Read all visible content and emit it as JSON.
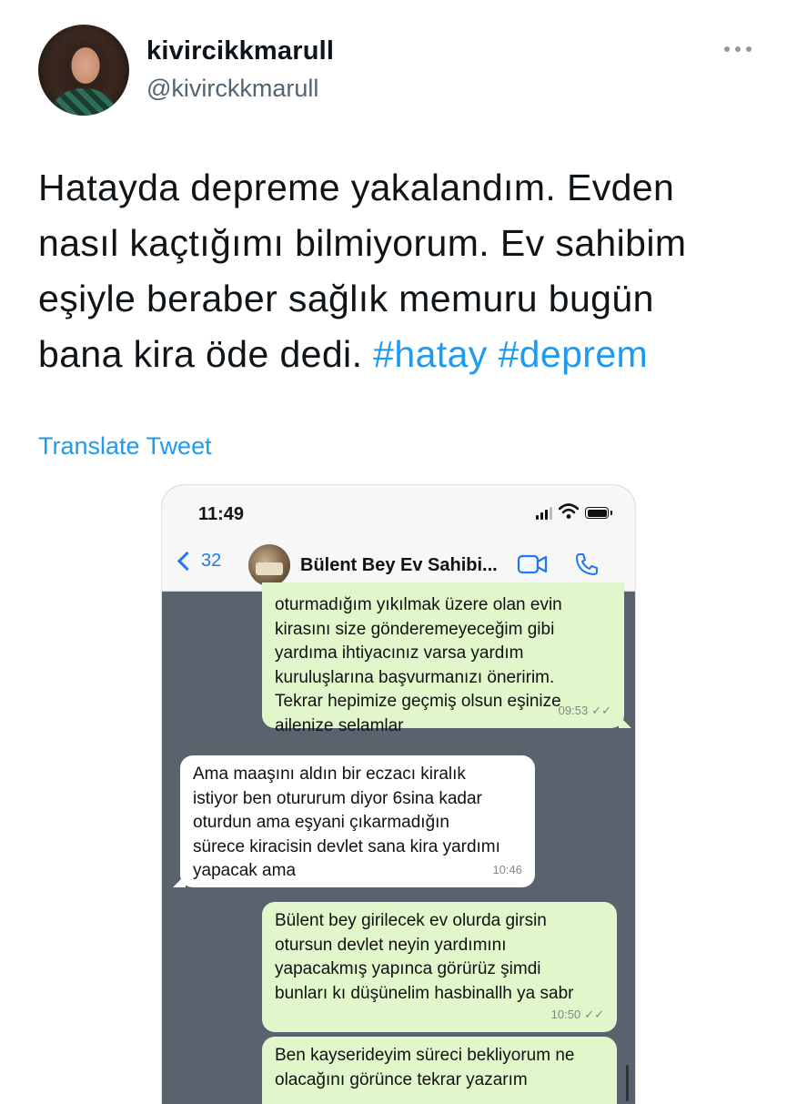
{
  "tweet": {
    "display_name": "kivircikkmarull",
    "handle": "@kivirckkmarull",
    "text_lines": [
      "Hatayda depreme yakalandım. Evden",
      "nasıl kaçtığımı bilmiyorum. Ev sahibim",
      "eşiyle beraber sağlık memuru bugün",
      "bana kira öde dedi."
    ],
    "hashtags": [
      "#hatay",
      "#deprem"
    ],
    "translate_label": "Translate Tweet",
    "avatar_icon": "profile-photo",
    "more_icon": "more-dots-icon"
  },
  "phone": {
    "status_time": "11:49",
    "back_count": "32",
    "contact_name": "Bülent Bey Ev Sahibi...",
    "icons": [
      "back-chevron-icon",
      "video-call-icon",
      "phone-call-icon",
      "signal-icon",
      "wifi-icon",
      "battery-icon"
    ],
    "colors": {
      "outgoing": "#e1f7cb",
      "incoming": "#ffffff",
      "chat_bg": "#5a636d",
      "accent": "#1d7af0"
    }
  },
  "messages": [
    {
      "direction": "outgoing",
      "lines": [
        "oturmadığım yıkılmak üzere olan evin",
        "kirasını size gönderemeyeceğim gibi",
        "yardıma ihtiyacınız varsa yardım",
        "kuruluşlarına başvurmanızı öneririm.",
        "Tekrar hepimize geçmiş olsun eşinize",
        "ailenize selamlar"
      ],
      "time": "09:53"
    },
    {
      "direction": "incoming",
      "lines": [
        "Ama maaşını aldın bir eczacı kiralık",
        "istiyor ben otururum diyor 6sina kadar",
        "oturdun ama eşyani çıkarmadığın",
        "sürece kiracisin devlet sana kira yardımı",
        "yapacak ama"
      ],
      "time": "10:46"
    },
    {
      "direction": "outgoing",
      "lines": [
        "Bülent bey girilecek ev olurda girsin",
        "otursun devlet neyin yardımını",
        "yapacakmış yapınca görürüz şimdi",
        "bunları kı düşünelim hasbinallh ya sabr"
      ],
      "time": "10:50"
    },
    {
      "direction": "outgoing",
      "lines": [
        "Ben kayserideyim süreci bekliyorum ne",
        "olacağını görünce tekrar yazarım"
      ],
      "time": ""
    }
  ]
}
